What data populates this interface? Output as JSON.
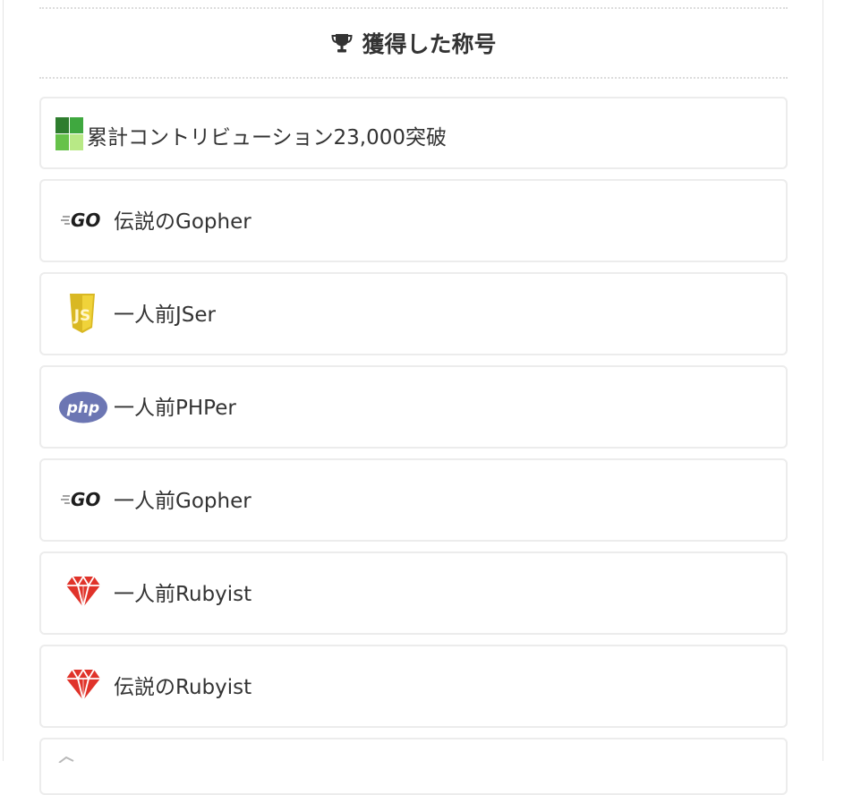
{
  "section": {
    "title": "獲得した称号",
    "icon": "trophy-icon"
  },
  "badges": [
    {
      "label": "累計コントリビューション23,000突破",
      "icon": "contribution-grid-icon"
    },
    {
      "label": "伝説のGopher",
      "icon": "go-logo-icon"
    },
    {
      "label": "一人前JSer",
      "icon": "js-shield-icon"
    },
    {
      "label": "一人前PHPer",
      "icon": "php-logo-icon"
    },
    {
      "label": "一人前Gopher",
      "icon": "go-logo-icon"
    },
    {
      "label": "一人前Rubyist",
      "icon": "ruby-gem-icon"
    },
    {
      "label": "伝説のRubyist",
      "icon": "ruby-gem-icon"
    }
  ],
  "colors": {
    "go": "#1e1e1e",
    "js": "#e9c832",
    "php": "#6c76b3",
    "ruby": "#e0332a",
    "contribution_dark": "#2e8b2e",
    "contribution_light": "#a8de62"
  }
}
